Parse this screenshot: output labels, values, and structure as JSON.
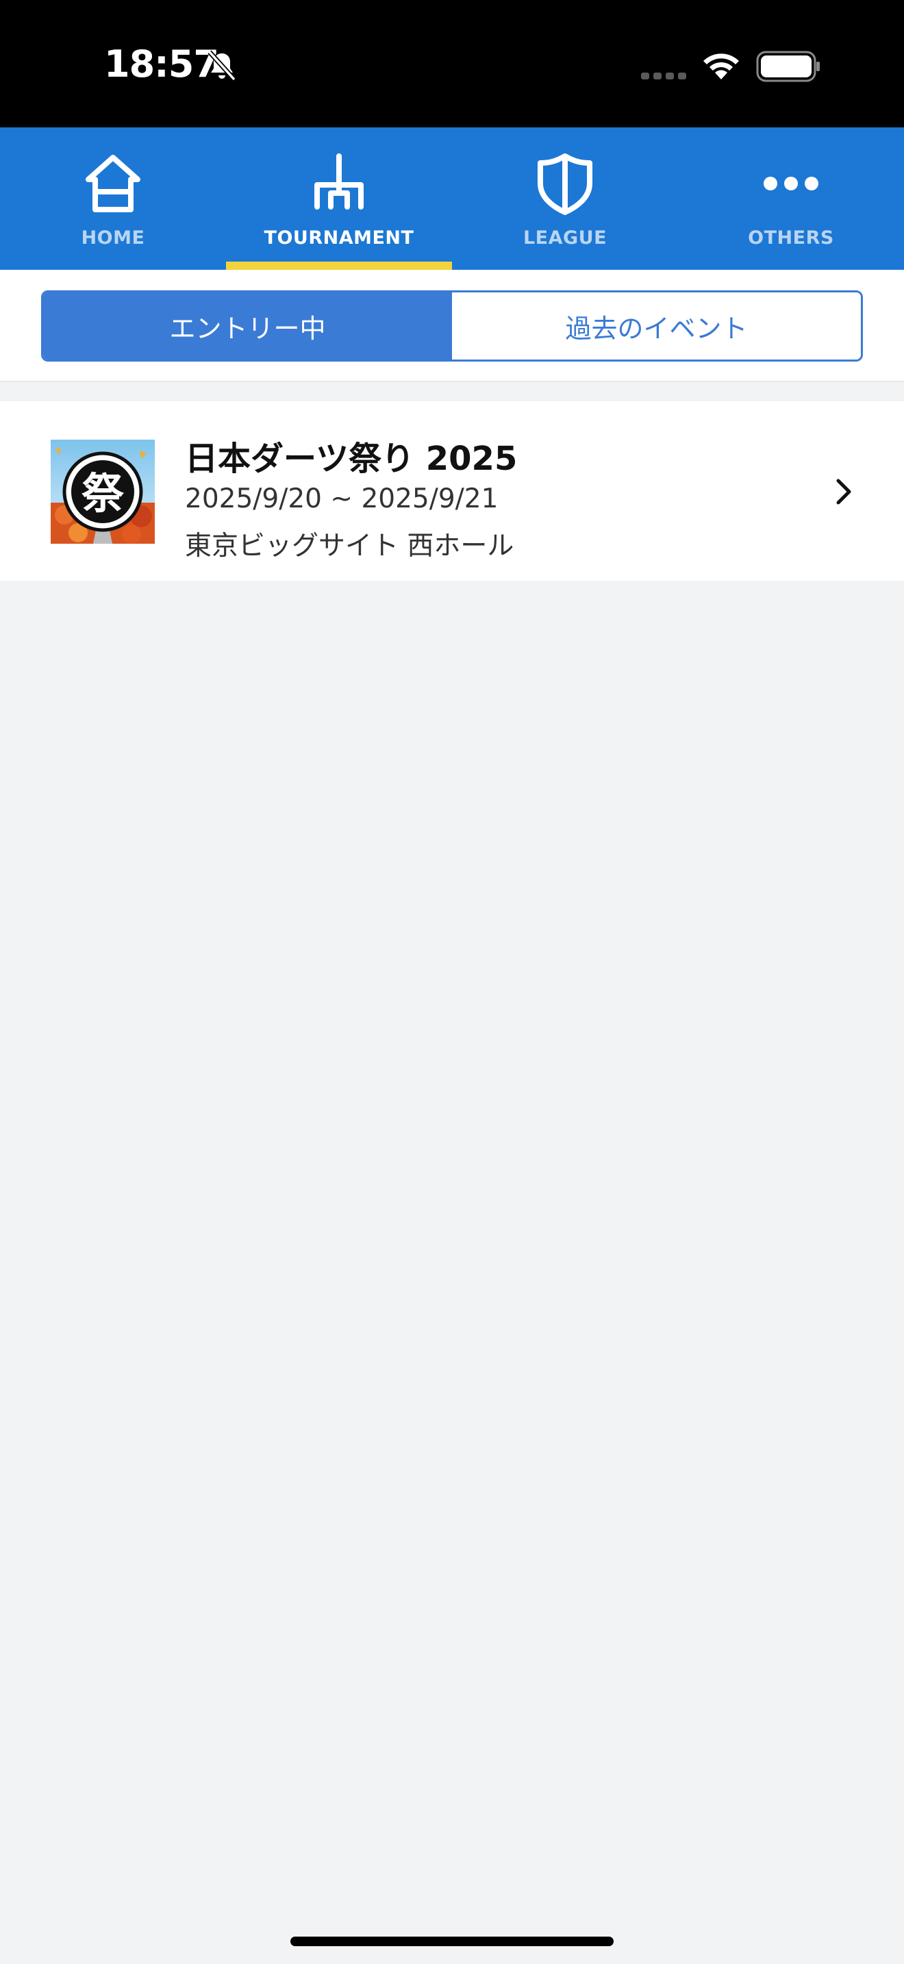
{
  "status_bar": {
    "time": "18:57",
    "icons": [
      "bell-slash-icon",
      "signal-icon",
      "wifi-icon",
      "battery-icon"
    ]
  },
  "tabs": [
    {
      "label": "HOME",
      "icon": "home-icon",
      "active": false
    },
    {
      "label": "TOURNAMENT",
      "icon": "bracket-icon",
      "active": true
    },
    {
      "label": "LEAGUE",
      "icon": "shield-icon",
      "active": false
    },
    {
      "label": "OTHERS",
      "icon": "more-dots-icon",
      "active": false
    }
  ],
  "segments": {
    "active": "エントリー中",
    "inactive": "過去のイベント"
  },
  "events": [
    {
      "title": "日本ダーツ祭り 2025",
      "dates": "2025/9/20 ~ 2025/9/21",
      "venue": "東京ビッグサイト 西ホール",
      "thumbnail_text": "祭"
    }
  ],
  "colors": {
    "primary": "#1c78d4",
    "segment_accent": "#3a7bd5",
    "tab_indicator": "#f2d33a",
    "background": "#f2f3f5"
  }
}
